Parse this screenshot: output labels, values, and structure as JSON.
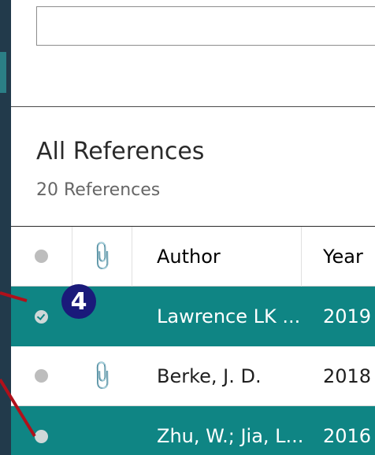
{
  "search": {
    "value": "",
    "placeholder": ""
  },
  "library": {
    "title": "All References",
    "count_label": "20 References"
  },
  "table": {
    "headers": {
      "read": "",
      "attachment": "",
      "author": "Author",
      "year": "Year"
    },
    "rows": [
      {
        "author": "Lawrence LK ...",
        "year": "2019",
        "read": true,
        "attachment": false,
        "selected": true
      },
      {
        "author": "Berke, J. D.",
        "year": "2018",
        "read": false,
        "attachment": true,
        "selected": false
      },
      {
        "author": "Zhu, W.; Jia, L...",
        "year": "2016",
        "read": false,
        "attachment": false,
        "selected": true
      }
    ]
  },
  "annotation": {
    "step_number": "4"
  },
  "colors": {
    "sidebar": "#223a4b",
    "selected_row": "#0f8584",
    "callout": "#1a1a7a",
    "pointer_line": "#b0101a"
  },
  "icons": {
    "read_status": "dot-icon",
    "attachment": "paperclip-icon",
    "check": "check-icon"
  }
}
